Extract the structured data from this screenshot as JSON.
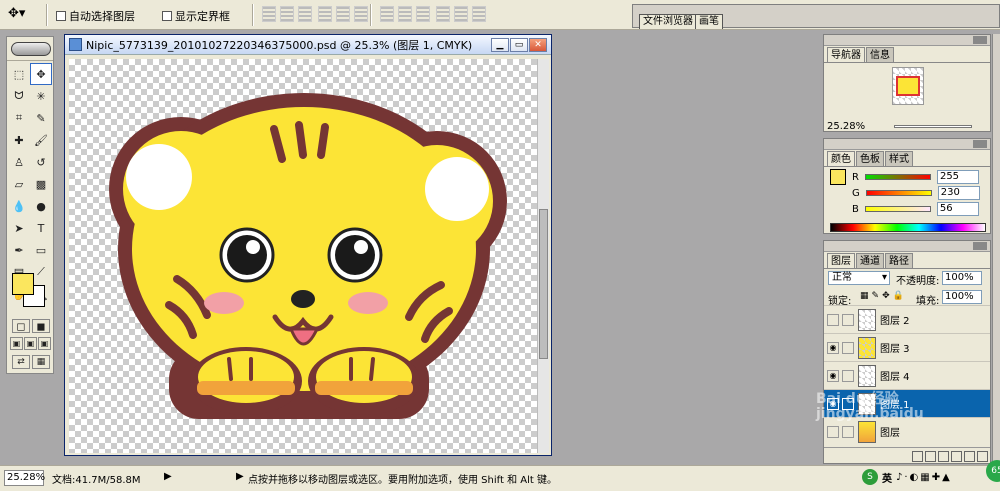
{
  "options": {
    "auto_select_label": "自动选择图层",
    "show_bounds_label": "显示定界框"
  },
  "palette_well": {
    "tab_file_browser": "文件浏览器",
    "tab_brushes": "画笔"
  },
  "document": {
    "title": "Nipic_5773139_20101027220346375000.psd @ 25.3% (图层 1, CMYK)"
  },
  "navigator": {
    "tabs": [
      "导航器",
      "信息"
    ],
    "zoom": "25.28%"
  },
  "color_panel": {
    "tabs": [
      "颜色",
      "色板",
      "样式"
    ],
    "r_label": "R",
    "g_label": "G",
    "b_label": "B",
    "r": "255",
    "g": "230",
    "b": "56",
    "fg_color": "#fbe65e"
  },
  "layers_panel": {
    "tabs": [
      "图层",
      "通道",
      "路径"
    ],
    "blend_mode": "正常",
    "opacity_label": "不透明度:",
    "opacity": "100%",
    "lock_label": "锁定:",
    "fill_label": "填充:",
    "fill": "100%",
    "layers": [
      {
        "name": "图层 2",
        "visible": false
      },
      {
        "name": "图层 3",
        "visible": true
      },
      {
        "name": "图层 4",
        "visible": true
      },
      {
        "name": "图层 1",
        "visible": true,
        "selected": true
      },
      {
        "name": "图层"
      }
    ]
  },
  "status": {
    "zoom": "25.28%",
    "doc_size": "文档:41.7M/58.8M",
    "hint": "点按并拖移以移动图层或选区。要用附加选项，使用 Shift 和 Alt 键。"
  },
  "taskbar": {
    "ime": "英"
  },
  "watermark": "Bai du 经验 jingyan.baidu"
}
